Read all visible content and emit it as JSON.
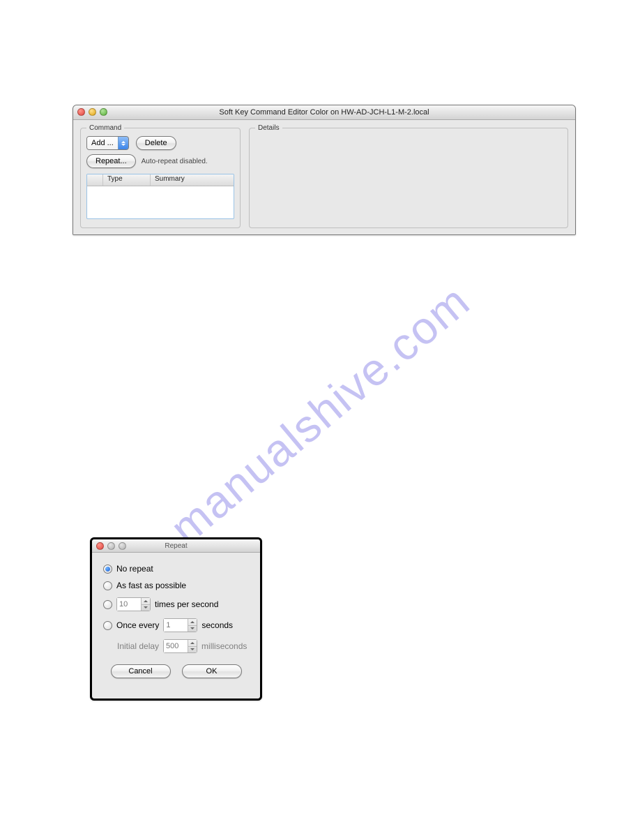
{
  "editor": {
    "title": "Soft Key Command Editor Color on  HW-AD-JCH-L1-M-2.local",
    "command_label": "Command",
    "details_label": "Details",
    "add_label": "Add ...",
    "delete_label": "Delete",
    "repeat_button_label": "Repeat...",
    "repeat_status": "Auto-repeat disabled.",
    "columns": {
      "type": "Type",
      "summary": "Summary"
    }
  },
  "repeat_dialog": {
    "title": "Repeat",
    "options": {
      "no_repeat": "No repeat",
      "as_fast": "As fast as possible",
      "times_per_sec_value": "10",
      "times_per_sec_suffix": "times per second",
      "once_every_prefix": "Once every",
      "once_every_value": "1",
      "once_every_suffix": "seconds"
    },
    "initial_delay_label": "Initial delay",
    "initial_delay_value": "500",
    "initial_delay_unit": "milliseconds",
    "cancel": "Cancel",
    "ok": "OK",
    "selected": "no_repeat"
  },
  "watermark": "manualshive.com"
}
